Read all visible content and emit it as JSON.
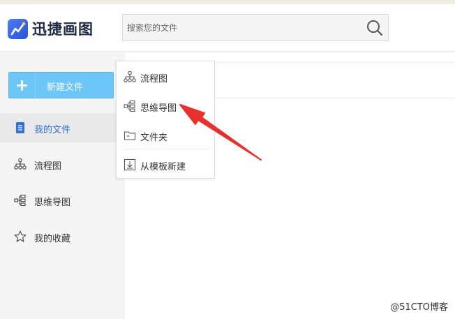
{
  "header": {
    "app_name": "迅捷画图",
    "search": {
      "placeholder": "搜索您的文件",
      "value": ""
    }
  },
  "sidebar": {
    "new_button_label": "新建文件",
    "items": [
      {
        "label": "我的文件",
        "icon": "document-icon",
        "active": true
      },
      {
        "label": "流程图",
        "icon": "flowchart-icon",
        "active": false
      },
      {
        "label": "思维导图",
        "icon": "mindmap-icon",
        "active": false
      },
      {
        "label": "我的收藏",
        "icon": "star-icon",
        "active": false
      }
    ]
  },
  "dropdown": {
    "items": [
      {
        "label": "流程图",
        "icon": "flowchart-icon"
      },
      {
        "label": "思维导图",
        "icon": "mindmap-icon"
      },
      {
        "label": "文件夹",
        "icon": "folder-icon"
      },
      {
        "label": "从模板新建",
        "icon": "template-import-icon"
      }
    ]
  },
  "watermark": "@51CTO博客",
  "colors": {
    "accent": "#2f6fe0",
    "new_button": "#6cc6f7",
    "annotation_arrow": "#e8312f"
  }
}
